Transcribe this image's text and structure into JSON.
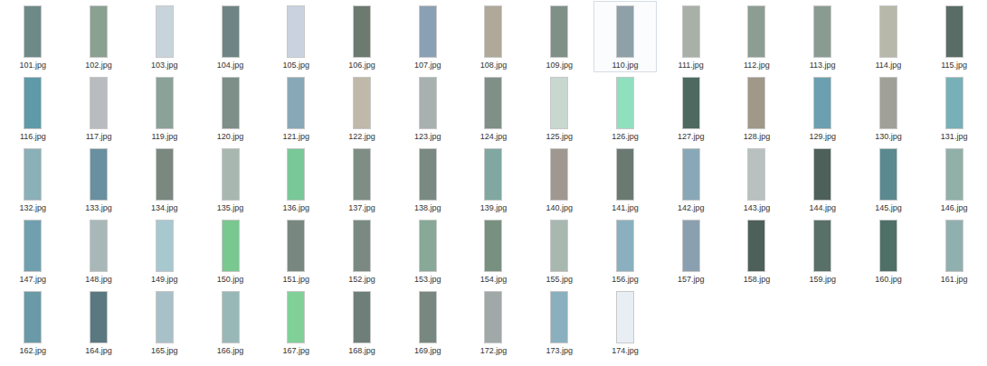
{
  "files": [
    {
      "name": "101.jpg",
      "selected": false,
      "color": "#6e8a88"
    },
    {
      "name": "102.jpg",
      "selected": false,
      "color": "#8aa090"
    },
    {
      "name": "103.jpg",
      "selected": false,
      "color": "#c8d4dc"
    },
    {
      "name": "104.jpg",
      "selected": false,
      "color": "#6f8585"
    },
    {
      "name": "105.jpg",
      "selected": false,
      "color": "#c9d2de"
    },
    {
      "name": "106.jpg",
      "selected": false,
      "color": "#6c7a70"
    },
    {
      "name": "107.jpg",
      "selected": false,
      "color": "#8aa0b4"
    },
    {
      "name": "108.jpg",
      "selected": false,
      "color": "#b0a898"
    },
    {
      "name": "109.jpg",
      "selected": false,
      "color": "#7f9088"
    },
    {
      "name": "110.jpg",
      "selected": true,
      "color": "#8ea0a8"
    },
    {
      "name": "111.jpg",
      "selected": false,
      "color": "#a8b0a8"
    },
    {
      "name": "112.jpg",
      "selected": false,
      "color": "#8c9e94"
    },
    {
      "name": "113.jpg",
      "selected": false,
      "color": "#8a9c92"
    },
    {
      "name": "114.jpg",
      "selected": false,
      "color": "#b8b8a8"
    },
    {
      "name": "115.jpg",
      "selected": false,
      "color": "#5a6c66"
    },
    {
      "name": "116.jpg",
      "selected": false,
      "color": "#5e9aa8"
    },
    {
      "name": "117.jpg",
      "selected": false,
      "color": "#b8bcc0"
    },
    {
      "name": "119.jpg",
      "selected": false,
      "color": "#8aa298"
    },
    {
      "name": "120.jpg",
      "selected": false,
      "color": "#7e8e88"
    },
    {
      "name": "121.jpg",
      "selected": false,
      "color": "#88a8b8"
    },
    {
      "name": "122.jpg",
      "selected": false,
      "color": "#c0b8a8"
    },
    {
      "name": "123.jpg",
      "selected": false,
      "color": "#a8b0b0"
    },
    {
      "name": "124.jpg",
      "selected": false,
      "color": "#7e9088"
    },
    {
      "name": "125.jpg",
      "selected": false,
      "color": "#c8d8d0"
    },
    {
      "name": "126.jpg",
      "selected": false,
      "color": "#90e0c0"
    },
    {
      "name": "127.jpg",
      "selected": false,
      "color": "#4e6a60"
    },
    {
      "name": "128.jpg",
      "selected": false,
      "color": "#a09888"
    },
    {
      "name": "129.jpg",
      "selected": false,
      "color": "#6aa0b0"
    },
    {
      "name": "130.jpg",
      "selected": false,
      "color": "#a0a098"
    },
    {
      "name": "131.jpg",
      "selected": false,
      "color": "#78b0b8"
    },
    {
      "name": "132.jpg",
      "selected": false,
      "color": "#8ab0b8"
    },
    {
      "name": "133.jpg",
      "selected": false,
      "color": "#6890a0"
    },
    {
      "name": "134.jpg",
      "selected": false,
      "color": "#7a8880"
    },
    {
      "name": "135.jpg",
      "selected": false,
      "color": "#a8b8b0"
    },
    {
      "name": "136.jpg",
      "selected": false,
      "color": "#78c898"
    },
    {
      "name": "137.jpg",
      "selected": false,
      "color": "#7e8e84"
    },
    {
      "name": "138.jpg",
      "selected": false,
      "color": "#7a8a82"
    },
    {
      "name": "139.jpg",
      "selected": false,
      "color": "#80a8a0"
    },
    {
      "name": "140.jpg",
      "selected": false,
      "color": "#a09890"
    },
    {
      "name": "141.jpg",
      "selected": false,
      "color": "#6a7a72"
    },
    {
      "name": "142.jpg",
      "selected": false,
      "color": "#88a8b8"
    },
    {
      "name": "143.jpg",
      "selected": false,
      "color": "#b8c0c0"
    },
    {
      "name": "144.jpg",
      "selected": false,
      "color": "#4e605a"
    },
    {
      "name": "145.jpg",
      "selected": false,
      "color": "#5a8a90"
    },
    {
      "name": "146.jpg",
      "selected": false,
      "color": "#90b0a8"
    },
    {
      "name": "147.jpg",
      "selected": false,
      "color": "#70a0b0"
    },
    {
      "name": "148.jpg",
      "selected": false,
      "color": "#a8b8b8"
    },
    {
      "name": "149.jpg",
      "selected": false,
      "color": "#a8c8d0"
    },
    {
      "name": "150.jpg",
      "selected": false,
      "color": "#78c890"
    },
    {
      "name": "151.jpg",
      "selected": false,
      "color": "#788880"
    },
    {
      "name": "152.jpg",
      "selected": false,
      "color": "#7a8a82"
    },
    {
      "name": "153.jpg",
      "selected": false,
      "color": "#88a898"
    },
    {
      "name": "154.jpg",
      "selected": false,
      "color": "#789080"
    },
    {
      "name": "155.jpg",
      "selected": false,
      "color": "#a8b8b0"
    },
    {
      "name": "156.jpg",
      "selected": false,
      "color": "#8ab0c0"
    },
    {
      "name": "157.jpg",
      "selected": false,
      "color": "#8aa0b0"
    },
    {
      "name": "158.jpg",
      "selected": false,
      "color": "#4e605a"
    },
    {
      "name": "159.jpg",
      "selected": false,
      "color": "#587068"
    },
    {
      "name": "160.jpg",
      "selected": false,
      "color": "#4e7066"
    },
    {
      "name": "161.jpg",
      "selected": false,
      "color": "#90b0b0"
    },
    {
      "name": "162.jpg",
      "selected": false,
      "color": "#6a9aa8"
    },
    {
      "name": "164.jpg",
      "selected": false,
      "color": "#5a7880"
    },
    {
      "name": "165.jpg",
      "selected": false,
      "color": "#a8c0c8"
    },
    {
      "name": "166.jpg",
      "selected": false,
      "color": "#98b8b8"
    },
    {
      "name": "167.jpg",
      "selected": false,
      "color": "#80d098"
    },
    {
      "name": "168.jpg",
      "selected": false,
      "color": "#6e7e78"
    },
    {
      "name": "169.jpg",
      "selected": false,
      "color": "#788880"
    },
    {
      "name": "172.jpg",
      "selected": false,
      "color": "#a0a8a8"
    },
    {
      "name": "173.jpg",
      "selected": false,
      "color": "#8ab0c0"
    },
    {
      "name": "174.jpg",
      "selected": false,
      "color": "#e8eef4"
    }
  ]
}
